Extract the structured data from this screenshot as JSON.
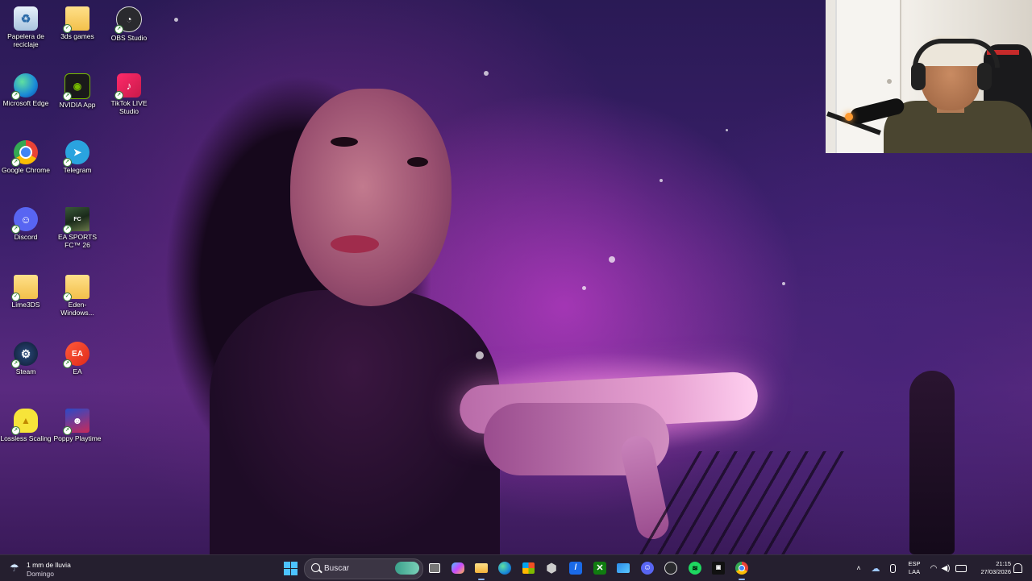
{
  "desktop_icons": [
    {
      "label": "Papelera de reciclaje",
      "icon": "recycle-bin-icon"
    },
    {
      "label": "3ds games",
      "icon": "folder-icon"
    },
    {
      "label": "OBS Studio",
      "icon": "obs-icon"
    },
    {
      "label": "Microsoft Edge",
      "icon": "edge-icon"
    },
    {
      "label": "NVIDIA App",
      "icon": "nvidia-icon"
    },
    {
      "label": "TikTok LIVE Studio",
      "icon": "tiktok-icon"
    },
    {
      "label": "Google Chrome",
      "icon": "chrome-icon"
    },
    {
      "label": "Telegram",
      "icon": "telegram-icon"
    },
    {
      "label": "Discord",
      "icon": "discord-icon"
    },
    {
      "label": "EA SPORTS FC™ 26",
      "icon": "ea-fc-icon"
    },
    {
      "label": "Lime3DS",
      "icon": "folder-icon"
    },
    {
      "label": "Eden-Windows...",
      "icon": "folder-icon"
    },
    {
      "label": "Steam",
      "icon": "steam-icon"
    },
    {
      "label": "EA",
      "icon": "ea-icon"
    },
    {
      "label": "Lossless Scaling",
      "icon": "lossless-scaling-icon"
    },
    {
      "label": "Poppy Playtime",
      "icon": "poppy-playtime-icon"
    }
  ],
  "taskbar": {
    "weather": {
      "line1": "1 mm de lluvia",
      "line2": "Domingo",
      "icon": "rain-cloud-icon"
    },
    "search_placeholder": "Buscar",
    "apps": [
      {
        "name": "start",
        "icon": "windows-icon"
      },
      {
        "name": "task-view",
        "icon": "task-view-icon"
      },
      {
        "name": "copilot",
        "icon": "copilot-icon"
      },
      {
        "name": "file-explorer",
        "icon": "folder-icon"
      },
      {
        "name": "edge",
        "icon": "edge-icon"
      },
      {
        "name": "store",
        "icon": "store-icon"
      },
      {
        "name": "settings",
        "icon": "hexagon-icon"
      },
      {
        "name": "app-blue",
        "icon": "blue-app-icon"
      },
      {
        "name": "xbox",
        "icon": "xbox-icon"
      },
      {
        "name": "mail",
        "icon": "mail-icon"
      },
      {
        "name": "discord",
        "icon": "discord-icon"
      },
      {
        "name": "obs",
        "icon": "obs-icon"
      },
      {
        "name": "spotify",
        "icon": "spotify-icon"
      },
      {
        "name": "game",
        "icon": "game-icon"
      },
      {
        "name": "chrome",
        "icon": "chrome-icon"
      }
    ],
    "tray": {
      "language_line1": "ESP",
      "language_line2": "LAA",
      "time": "21:15",
      "date": "27/03/2026"
    }
  },
  "colors": {
    "taskbar_bg": "#1c1626",
    "accent": "#4cc2ff",
    "wallpaper_purple": "#5a2a80"
  }
}
